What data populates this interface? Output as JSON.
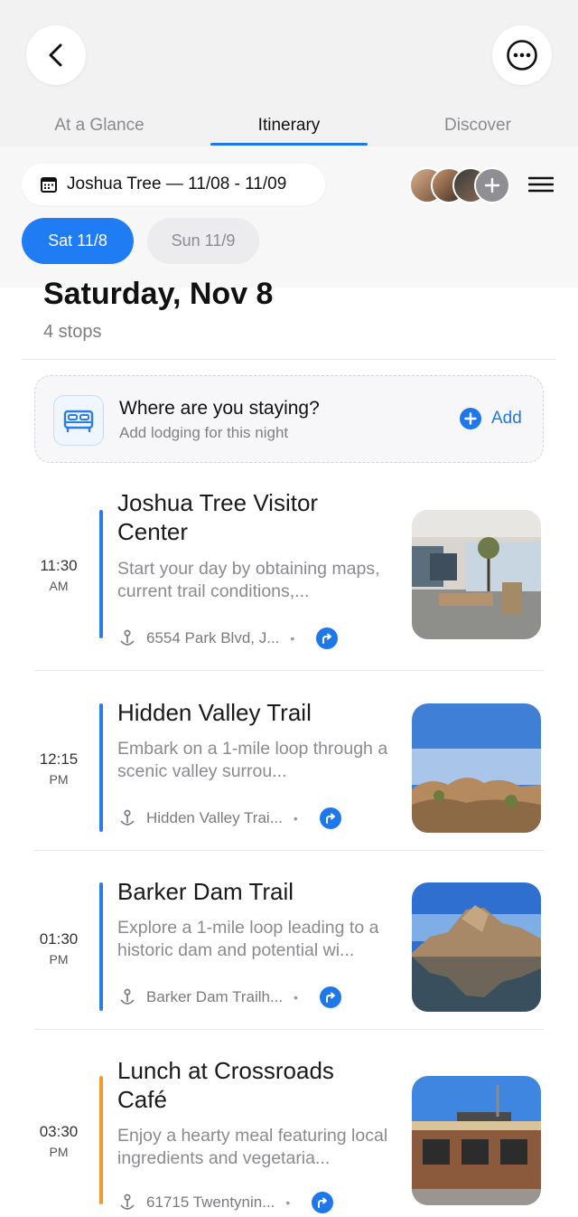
{
  "tabs": [
    {
      "label": "At a Glance",
      "active": false
    },
    {
      "label": "Itinerary",
      "active": true
    },
    {
      "label": "Discover",
      "active": false
    }
  ],
  "trip": {
    "label": "Joshua Tree — 11/08 - 11/09"
  },
  "days": [
    {
      "label": "Sat 11/8",
      "active": true
    },
    {
      "label": "Sun 11/9",
      "active": false
    }
  ],
  "day_header": {
    "title": "Saturday, Nov 8",
    "stops": "4 stops"
  },
  "lodging": {
    "question": "Where are you staying?",
    "subtitle": "Add lodging for this night",
    "add_label": "Add"
  },
  "stops": [
    {
      "time": "11:30",
      "ampm": "AM",
      "title": "Joshua Tree Visitor Center",
      "description": "Start your day by obtaining maps, current trail conditions,...",
      "address": "6554 Park Blvd, J...",
      "category_color": "#2a7de9"
    },
    {
      "time": "12:15",
      "ampm": "PM",
      "title": "Hidden Valley Trail",
      "description": "Embark on a 1-mile loop through a scenic valley surrou...",
      "address": "Hidden Valley Trai...",
      "category_color": "#2a7de9"
    },
    {
      "time": "01:30",
      "ampm": "PM",
      "title": "Barker Dam Trail",
      "description": "Explore a 1-mile loop leading to a historic dam and potential wi...",
      "address": "Barker Dam Trailh...",
      "category_color": "#2a7de9"
    },
    {
      "time": "03:30",
      "ampm": "PM",
      "title": "Lunch at Crossroads Café",
      "description": "Enjoy a hearty meal featuring local ingredients and vegetaria...",
      "address": "61715 Twentynin...",
      "category_color": "#f39a2a"
    }
  ],
  "colors": {
    "accent": "#1f78ea",
    "background": "#f2f2f3"
  },
  "icons": [
    "back-chevron-icon",
    "more-ellipsis-icon",
    "calendar-icon",
    "hamburger-menu-icon",
    "bed-icon",
    "plus-circle-icon",
    "location-pin-icon",
    "directions-icon"
  ]
}
